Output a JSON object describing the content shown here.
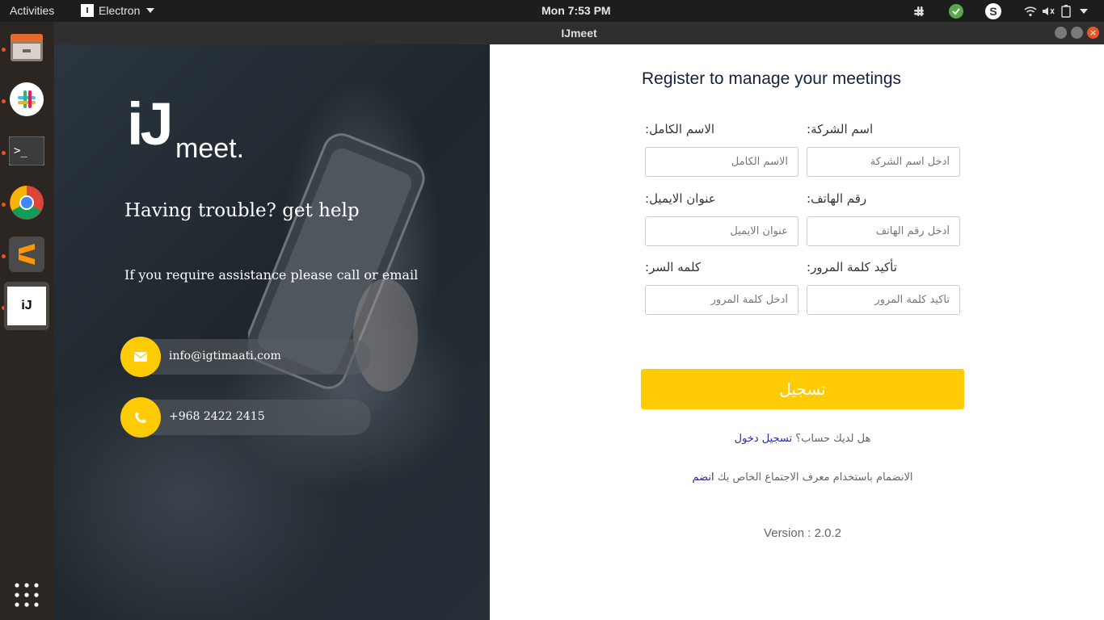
{
  "system": {
    "activities": "Activities",
    "app_name": "Electron",
    "clock": "Mon  7:53 PM"
  },
  "window": {
    "title": "IJmeet"
  },
  "dock": {
    "items": [
      "files-icon",
      "slack-icon",
      "terminal-icon",
      "chrome-icon",
      "sublime-icon",
      "ijmeet-icon",
      "show-apps-icon"
    ]
  },
  "brand": {
    "logo_ij": "iJ",
    "logo_meet": "meet."
  },
  "help": {
    "title": "Having trouble? get help",
    "subtitle": "If you require assistance please call or email",
    "email": "info@igtimaati.com",
    "phone": "+968 2422 2415"
  },
  "form": {
    "heading": "Register to manage your meetings",
    "full_name_label": ":الاسم الكامل",
    "full_name_placeholder": "الاسم الكامل",
    "company_label": ":اسم الشركة",
    "company_placeholder": "أدخل اسم الشركة",
    "email_label": ":عنوان الايميل",
    "email_placeholder": "عنوان الايميل",
    "phone_label": ":رقم الهاتف",
    "phone_placeholder": "أدخل رقم الهاتف",
    "password_label": ":كلمه السر",
    "password_placeholder": "أدخل كلمة المرور",
    "confirm_label": ":تأكيد كلمة المرور",
    "confirm_placeholder": "تأكيد كلمة المرور",
    "register_button": "تسجيل",
    "have_account_text": "هل لديك حساب؟",
    "login_link": "تسجيل دخول",
    "join_text": "الانضمام باستخدام معرف الاجتماع الخاص بك",
    "join_link": "انضم",
    "version": "Version : 2.0.2"
  },
  "colors": {
    "accent": "#ffcb05",
    "heading": "#14213d",
    "link": "#2a2a9a"
  }
}
